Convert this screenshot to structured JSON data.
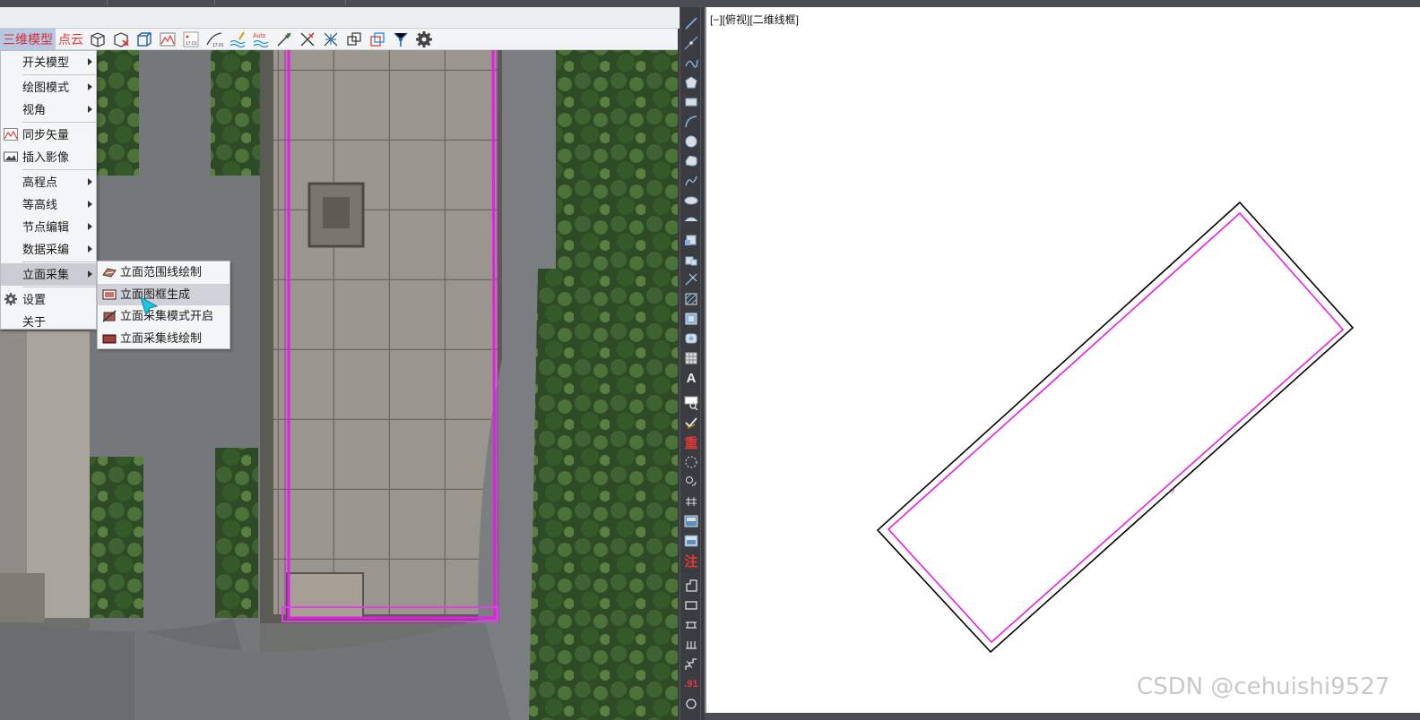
{
  "toolbar": {
    "menu_3d_model": "三维模型",
    "menu_point_cloud": "点云",
    "icons": [
      "cube-outline-icon",
      "cube-delete-icon",
      "cube-wire-icon",
      "image-chart-icon",
      "elevation-point-icon",
      "contour-label-icon",
      "pen-contour-icon",
      "auto-contour-icon",
      "node-add-icon",
      "node-delete-icon",
      "node-move-icon",
      "copy-box-icon",
      "overlap-box-icon",
      "snap-lines-icon",
      "settings-icon"
    ],
    "auto_label": "Auto",
    "elev_label": "17.01"
  },
  "menu": {
    "items": [
      {
        "label": "开关模型",
        "submenu": true
      },
      {
        "label": "绘图模式",
        "submenu": true
      },
      {
        "label": "视角",
        "submenu": true
      },
      {
        "label": "同步矢量",
        "submenu": false
      },
      {
        "label": "插入影像",
        "submenu": false
      },
      {
        "label": "高程点",
        "submenu": true
      },
      {
        "label": "等高线",
        "submenu": true
      },
      {
        "label": "节点编辑",
        "submenu": true
      },
      {
        "label": "数据采编",
        "submenu": true
      },
      {
        "label": "立面采集",
        "submenu": true
      },
      {
        "label": "设置",
        "submenu": false
      },
      {
        "label": "关于",
        "submenu": false
      }
    ]
  },
  "submenu": {
    "items": [
      {
        "label": "立面范围线绘制"
      },
      {
        "label": "立面图框生成"
      },
      {
        "label": "立面采集模式开启"
      },
      {
        "label": "立面采集线绘制"
      }
    ]
  },
  "cad": {
    "view_label": "[−][俯视][二维线框]"
  },
  "vtoolbar": {
    "text_A": "A",
    "text_heavy": "重",
    "text_note": "注",
    "text_91": ".91"
  },
  "colors": {
    "menu_accent": "#e53935",
    "outline_magenta": "#e81ce8",
    "cad_outline": "#000000"
  },
  "watermark": "CSDN @cehuishi9527"
}
